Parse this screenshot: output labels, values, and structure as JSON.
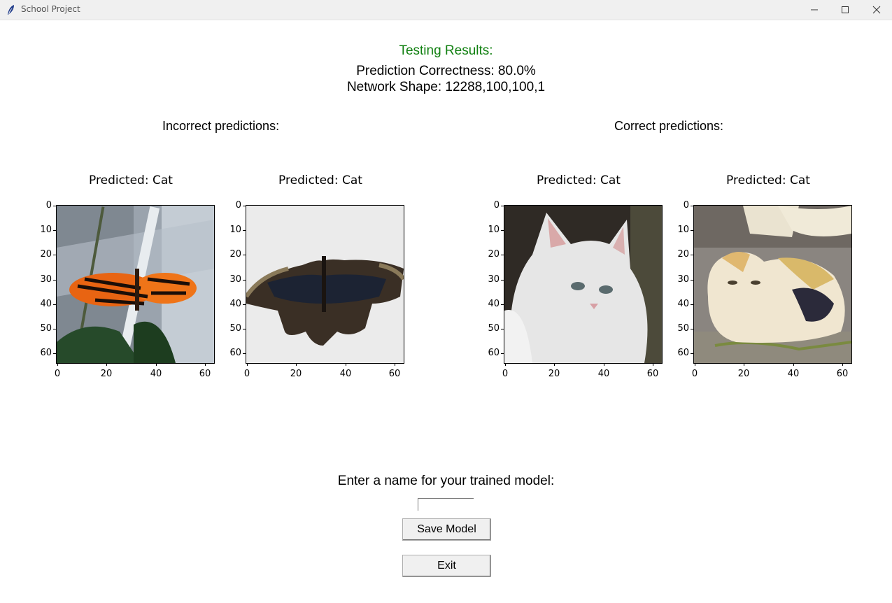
{
  "window": {
    "title": "School Project",
    "icon": "feather-icon",
    "controls": [
      "minimize-icon",
      "maximize-icon",
      "close-icon"
    ]
  },
  "header": {
    "testing_results": "Testing Results:",
    "prediction_correctness": "Prediction Correctness: 80.0%",
    "network_shape": "Network Shape: 12288,100,100,1"
  },
  "sections": {
    "incorrect": "Incorrect predictions:",
    "correct": "Correct predictions:"
  },
  "plots": [
    {
      "title": "Predicted: Cat",
      "image": "orange-butterfly"
    },
    {
      "title": "Predicted: Cat",
      "image": "dark-butterfly"
    },
    {
      "title": "Predicted: Cat",
      "image": "white-cat"
    },
    {
      "title": "Predicted: Cat",
      "image": "calico-cat"
    }
  ],
  "axis": {
    "y_ticks": [
      "0",
      "10",
      "20",
      "30",
      "40",
      "50",
      "60"
    ],
    "x_ticks": [
      "0",
      "20",
      "40",
      "60"
    ]
  },
  "save": {
    "prompt": "Enter a name for your trained model:",
    "input_value": "",
    "save_label": "Save Model",
    "exit_label": "Exit"
  },
  "colors": {
    "heading_green": "#118011",
    "button_bg": "#f0f0f0"
  }
}
